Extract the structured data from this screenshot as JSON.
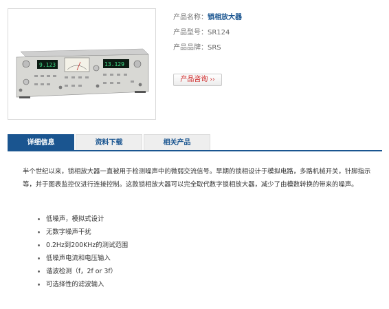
{
  "product": {
    "name_label": "产品名称：",
    "name_value": "锁相放大器",
    "model_label": "产品型号：",
    "model_value": "SR124",
    "brand_label": "产品品牌：",
    "brand_value": "SRS",
    "consult_button": "产品咨询",
    "consult_arrows": "››",
    "display_left": "9.123",
    "display_right": "13.129"
  },
  "tabs": [
    {
      "label": "详细信息",
      "active": true
    },
    {
      "label": "资料下载",
      "active": false
    },
    {
      "label": "相关产品",
      "active": false
    }
  ],
  "description": "半个世纪以来，锁相放大器一直被用于检测噪声中的微弱交流信号。早期的锁相设计于模拟电路，多路机械开关，针脚指示等，并于图表监控仪进行连接控制。这款锁相放大器可以完全取代数字锁相放大器，减少了由模数转换的带来的噪声。",
  "features": [
    "低噪声，模拟式设计",
    "无数字噪声干扰",
    "0.2Hz到200KHz的测试范围",
    "低噪声电流和电压输入",
    "谐波检测（f，2f or 3f）",
    "可选择性的滤波输入"
  ],
  "colors": {
    "brand": "#1a5590",
    "consult_text": "#cc1d1d"
  }
}
